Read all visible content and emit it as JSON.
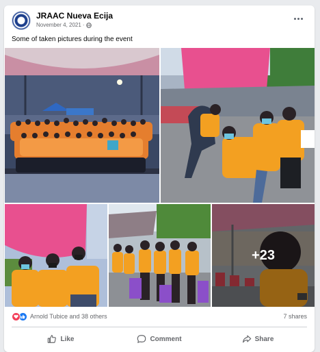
{
  "post": {
    "page_name": "JRAAC Nueva Ecija",
    "date": "November 4, 2021",
    "separator": "·",
    "privacy_icon": "globe-icon",
    "more_icon": "more-options-icon",
    "caption": "Some of taken pictures during the event"
  },
  "gallery": {
    "more_count": "+23"
  },
  "engagement": {
    "reaction_icons": [
      "love-reaction-icon",
      "like-reaction-icon"
    ],
    "reactions_text": "Arnold Tubice and 38 others",
    "shares_text": "7 shares"
  },
  "actions": {
    "like_label": "Like",
    "comment_label": "Comment",
    "share_label": "Share"
  },
  "colors": {
    "brand_blue": "#1877f2",
    "love_red": "#f33e58",
    "shirt_orange": "#f3a021",
    "canopy_pink": "#e8508f"
  }
}
